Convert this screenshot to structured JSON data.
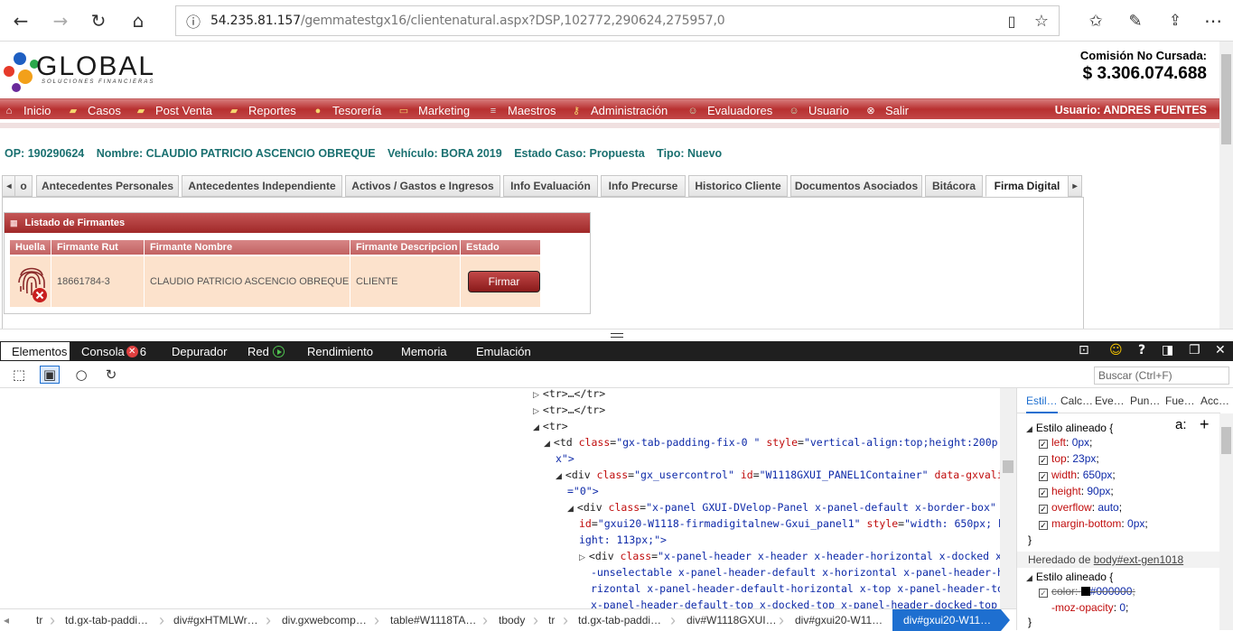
{
  "browser": {
    "url_host": "54.235.81.157",
    "url_path": "/gemmatestgx16/clientenatural.aspx?DSP,102772,290624,275957,0",
    "icons": [
      "back-arrow-icon",
      "forward-arrow-icon",
      "refresh-icon",
      "home-icon",
      "info-icon",
      "reading-view-icon",
      "favorite-star-icon",
      "favorites-hub-icon",
      "pen-icon",
      "share-icon",
      "more-icon"
    ]
  },
  "header": {
    "logo_word": "GLOBAL",
    "logo_sub": "SOLUCIONES FINANCIERAS",
    "commission_label": "Comisión No Cursada:",
    "commission_value": "$ 3.306.074.688"
  },
  "menu": {
    "items": [
      "Inicio",
      "Casos",
      "Post Venta",
      "Reportes",
      "Tesorería",
      "Marketing",
      "Maestros",
      "Administración",
      "Evaluadores",
      "Usuario",
      "Salir"
    ],
    "user": "Usuario:  ANDRES FUENTES"
  },
  "case_info": {
    "op": "OP: 190290624",
    "nombre": "Nombre: CLAUDIO PATRICIO ASCENCIO OBREQUE",
    "vehiculo": "Vehículo: BORA 2019",
    "estado": "Estado Caso: Propuesta",
    "tipo": "Tipo: Nuevo"
  },
  "tabs": [
    "o",
    "Antecedentes Personales",
    "Antecedentes Independiente",
    "Activos / Gastos e Ingresos",
    "Info Evaluación",
    "Info Precurse",
    "Historico Cliente",
    "Documentos Asociados",
    "Bitácora",
    "Firma Digital"
  ],
  "panel": {
    "title": "Listado de Firmantes",
    "columns": [
      "Huella",
      "Firmante Rut",
      "Firmante Nombre",
      "Firmante Descripcion",
      "Estado"
    ],
    "row": {
      "rut": "18661784-3",
      "nombre": "CLAUDIO PATRICIO ASCENCIO OBREQUE",
      "descripcion": "CLIENTE",
      "button": "Firmar"
    }
  },
  "devtools": {
    "tabs": [
      "Elementos",
      "Consola",
      "Depurador",
      "Red",
      "Rendimiento",
      "Memoria",
      "Emulación"
    ],
    "console_errors": "6",
    "search_placeholder": "Buscar (Ctrl+F)",
    "dom": {
      "l1": "<tr>…</tr>",
      "l2": "<tr>…</tr>",
      "l3": "<tr>",
      "l4_tag": "<td ",
      "l4_a1": "class",
      "l4_v1": "\"gx-tab-padding-fix-0 \"",
      "l4_a2": "style",
      "l4_v2": "\"vertical-align:top;height:200p",
      "l4b": "x\">",
      "l5_tag": "<div ",
      "l5_a1": "class",
      "l5_v1": "\"gx_usercontrol\"",
      "l5_a2": "id",
      "l5_v2": "\"W1118GXUI_PANEL1Container\"",
      "l5_a3": "data-gxvalid",
      "l5b": "=\"0\">",
      "l6_tag": "<div ",
      "l6_a1": "class",
      "l6_v1": "\"x-panel GXUI-DVelop-Panel x-panel-default x-border-box\"",
      "l6b_a": "id",
      "l6b_v": "\"gxui20-W1118-firmadigitalnew-Gxui_panel1\"",
      "l6b_a2": "style",
      "l6b_v2": "\"width: 650px; he",
      "l6c": "ight: 113px;\">",
      "l7_tag": "<div ",
      "l7_a1": "class",
      "l7_v1": "\"x-panel-header x-header x-header-horizontal x-docked x",
      "l7b": "-unselectable x-panel-header-default x-horizontal x-panel-header-ho",
      "l7c": "rizontal x-panel-header-default-horizontal x-top x-panel-header-top",
      "l7d": "x-panel-header-default-top x-docked-top x-panel-header-docked-top x"
    },
    "styles_tabs": [
      "Estil…",
      "Calc…",
      "Eve…",
      "Pun…",
      "Fue…",
      "Acc…"
    ],
    "styles": {
      "rule1": "Estilo alineado  {",
      "props": [
        [
          "left",
          "0px"
        ],
        [
          "top",
          "23px"
        ],
        [
          "width",
          "650px"
        ],
        [
          "height",
          "90px"
        ],
        [
          "overflow",
          "auto"
        ],
        [
          "margin-bottom",
          "0px"
        ]
      ],
      "close1": "}",
      "inherited_label": "Heredado de ",
      "inherited_link": "body#ext-gen1018",
      "rule2": "Estilo alineado  {",
      "color_prop": "color",
      "color_val": "#000000",
      "moz_prop": "-moz-opacity",
      "moz_val": "0",
      "close2": "}"
    },
    "breadcrumbs": [
      "tr",
      "td.gx-tab-paddi…",
      "div#gxHTMLWr…",
      "div.gxwebcomp…",
      "table#W1118TA…",
      "tbody",
      "tr",
      "td.gx-tab-paddi…",
      "div#W1118GXUI…",
      "div#gxui20-W11…",
      "div#gxui20-W11…"
    ]
  }
}
